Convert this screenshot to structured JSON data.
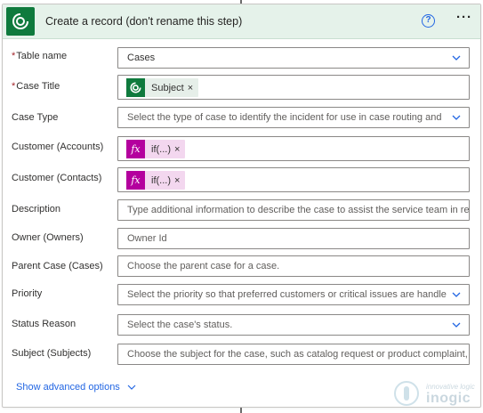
{
  "header": {
    "title": "Create a record (don't rename this step)",
    "help_icon": "?",
    "more_icon": "···"
  },
  "fields": {
    "table_name": {
      "label": "Table name",
      "required": true,
      "value": "Cases"
    },
    "case_title": {
      "label": "Case Title",
      "required": true,
      "token": "Subject"
    },
    "case_type": {
      "label": "Case Type",
      "placeholder": "Select the type of case to identify the incident for use in case routing and"
    },
    "customer_accounts": {
      "label": "Customer (Accounts)",
      "token": "if(...)"
    },
    "customer_contacts": {
      "label": "Customer (Contacts)",
      "token": "if(...)"
    },
    "description": {
      "label": "Description",
      "placeholder": "Type additional information to describe the case to assist the service team in re"
    },
    "owner": {
      "label": "Owner (Owners)",
      "placeholder": "Owner Id"
    },
    "parent_case": {
      "label": "Parent Case (Cases)",
      "placeholder": "Choose the parent case for a case."
    },
    "priority": {
      "label": "Priority",
      "placeholder": "Select the priority so that preferred customers or critical issues are handle"
    },
    "status_reason": {
      "label": "Status Reason",
      "placeholder": "Select the case's status."
    },
    "subject": {
      "label": "Subject (Subjects)",
      "placeholder": "Choose the subject for the case, such as catalog request or product complaint,"
    }
  },
  "required_marker": "*",
  "token_close": "×",
  "fx_label": "fx",
  "advanced_link": "Show advanced options",
  "watermark": {
    "small": "innovative logic",
    "big": "inogic"
  },
  "colors": {
    "dataverse_green": "#0f7a3d",
    "expression_pink": "#b4009e",
    "link_blue": "#2266e3",
    "header_bg": "#e5f2ea"
  },
  "icons": [
    "dataverse-icon",
    "help-icon",
    "more-options-icon",
    "chevron-down-icon",
    "fx-expression-icon",
    "close-icon"
  ]
}
